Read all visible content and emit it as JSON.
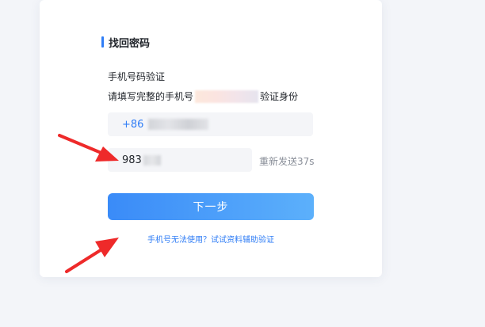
{
  "section": {
    "title": "找回密码"
  },
  "verify": {
    "subtitle": "手机号码验证",
    "desc_prefix": "请填写完整的手机号",
    "desc_suffix": "验证身份"
  },
  "phone": {
    "prefix": "+86"
  },
  "code": {
    "value": "983",
    "resend_label": "重新发送37s"
  },
  "next_button": {
    "label": "下一步"
  },
  "alt_link": {
    "label": "手机号无法使用？试试资料辅助验证"
  },
  "colors": {
    "accent": "#2f7df6",
    "annotation_arrow": "#ee2a2a"
  }
}
